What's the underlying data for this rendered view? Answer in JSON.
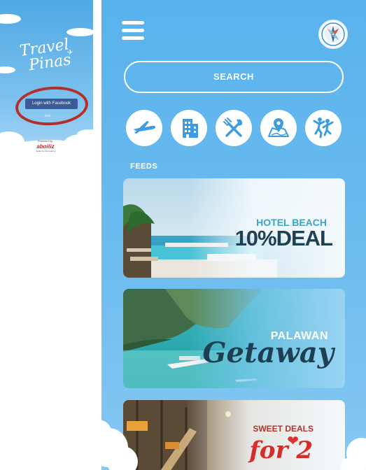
{
  "login": {
    "title_line1": "Travel",
    "title_line2": "Pinas",
    "facebook_button": "Login with Facebook",
    "skip": "skip",
    "powered_by": "Powered by:",
    "brand": "aboitiz",
    "brand_tagline": "better for the heat up"
  },
  "home": {
    "search_label": "SEARCH",
    "categories": [
      {
        "name": "flights",
        "icon": "airplane-icon"
      },
      {
        "name": "hotels",
        "icon": "building-icon"
      },
      {
        "name": "restaurants",
        "icon": "fork-knife-icon"
      },
      {
        "name": "maps",
        "icon": "map-pin-icon"
      },
      {
        "name": "activities",
        "icon": "people-jumping-icon"
      }
    ],
    "feeds_label": "FEEDS",
    "feeds": [
      {
        "subtitle": "HOTEL BEACH",
        "title": "10%DEAL"
      },
      {
        "subtitle": "PALAWAN",
        "title": "Getaway"
      },
      {
        "subtitle": "SWEET DEALS",
        "title": "for 2"
      }
    ]
  },
  "colors": {
    "sky_blue": "#58b2ec",
    "facebook_blue": "#3b5a9a",
    "highlight_red": "#b42f2a",
    "dark_navy": "#1f3f52"
  }
}
